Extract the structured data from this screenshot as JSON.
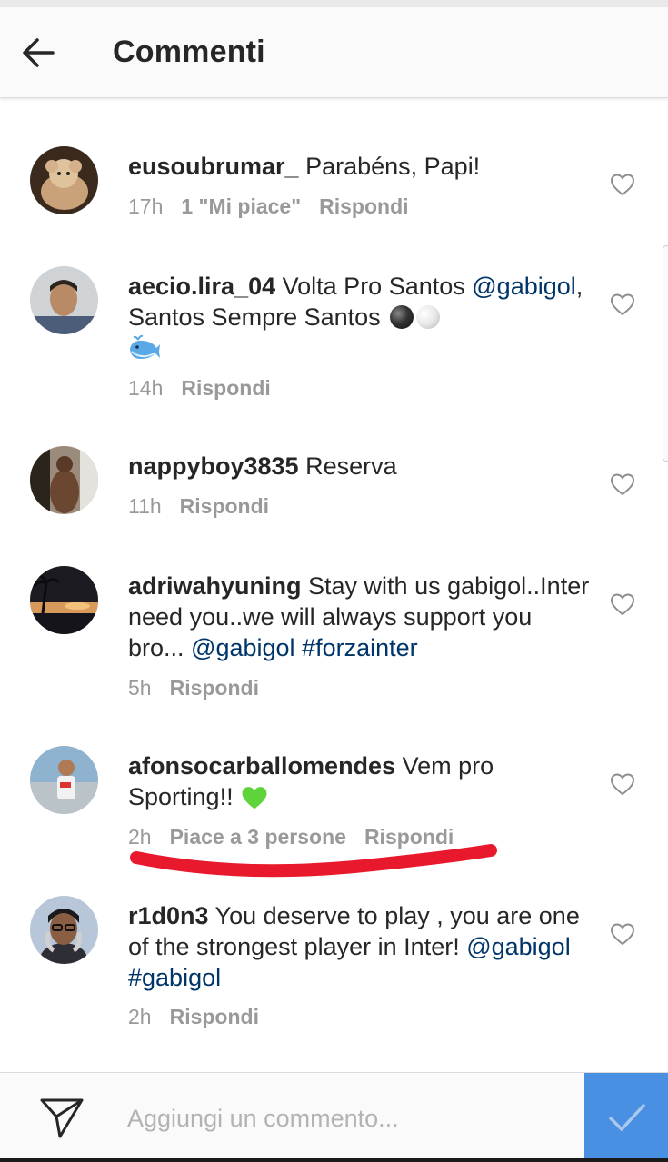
{
  "header": {
    "title": "Commenti",
    "back_icon": "arrow-left-icon"
  },
  "comments": [
    {
      "username": "eusoubrumar_",
      "text": " Parabéns, Papi!",
      "time": "17h",
      "likes": "1 \"Mi piace\"",
      "reply": "Rispondi"
    },
    {
      "username": "aecio.lira_04",
      "text_before": " Volta Pro Santos ",
      "mention": "@gabigol",
      "text_after": ", Santos Sempre Santos ",
      "emojis": [
        "black-ball-emoji",
        "white-ball-emoji",
        "whale-emoji"
      ],
      "time": "14h",
      "reply": "Rispondi"
    },
    {
      "username": "nappyboy3835",
      "text": " Reserva",
      "time": "11h",
      "reply": "Rispondi"
    },
    {
      "username": "adriwahyuning",
      "text": " Stay with us gabigol..Inter need you..we will always support you bro... ",
      "mention": "@gabigol",
      "hashtag": "#forzainter",
      "time": "5h",
      "reply": "Rispondi"
    },
    {
      "username": "afonsocarballomendes",
      "text": " Vem pro Sporting!! ",
      "emojis": [
        "green-heart-emoji"
      ],
      "time": "2h",
      "likes": "Piace a 3 persone",
      "reply": "Rispondi"
    },
    {
      "username": "r1d0n3",
      "text": " You deserve to play , you are one of the strongest player in Inter! ",
      "mention": "@gabigol",
      "hashtag": "#gabigol",
      "time": "2h",
      "reply": "Rispondi"
    }
  ],
  "composer": {
    "placeholder": "Aggiungi un commento...",
    "send_icon": "paper-plane-icon",
    "post_icon": "checkmark-icon"
  },
  "colors": {
    "text": "#262626",
    "meta": "#999999",
    "link": "#003569",
    "post_button": "#4a90e2",
    "annotation": "#e8192c"
  }
}
